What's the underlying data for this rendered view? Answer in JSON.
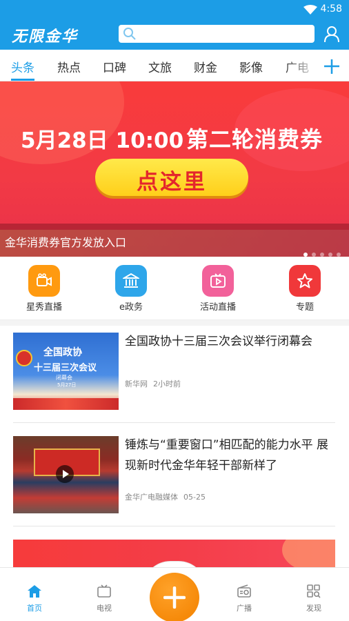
{
  "status_bar": {
    "time": "4:58"
  },
  "app": {
    "logo_text": "无限金华"
  },
  "search": {
    "placeholder": ""
  },
  "tabs": [
    {
      "label": "头条",
      "active": true
    },
    {
      "label": "热点"
    },
    {
      "label": "口碑"
    },
    {
      "label": "文旅"
    },
    {
      "label": "财金"
    },
    {
      "label": "影像"
    },
    {
      "label": "广电"
    }
  ],
  "banner": {
    "date_text": "5月28日 10:00",
    "title_text": "第二轮消费券",
    "button_text": "点这里",
    "caption": "金华消费券官方发放入口",
    "active_slide": 1,
    "slide_count": 5
  },
  "quick_actions": [
    {
      "label": "星秀直播",
      "icon": "camera-icon",
      "color": "#ff9a10"
    },
    {
      "label": "e政务",
      "icon": "government-building-icon",
      "color": "#2ea6ea"
    },
    {
      "label": "活动直播",
      "icon": "tv-play-icon",
      "color": "#f2619a"
    },
    {
      "label": "专题",
      "icon": "star-icon",
      "color": "#f0383a"
    }
  ],
  "news": [
    {
      "title": "全国政协十三届三次会议举行闭幕会",
      "source": "新华网",
      "time": "2小时前",
      "thumb_text": {
        "line1": "全国政协",
        "line2": "十三届三次会议",
        "line3": "闭幕会",
        "line4": "5月27日"
      }
    },
    {
      "title": "锤炼与“重要窗口”相匹配的能力水平 展现新时代金华年轻干部新样了",
      "source": "金华广电融媒体",
      "time": "05-25"
    }
  ],
  "bottom_nav": [
    {
      "label": "首页",
      "icon": "home-icon",
      "active": true
    },
    {
      "label": "电视",
      "icon": "tv-icon"
    },
    {
      "label": "广播",
      "icon": "radio-icon"
    },
    {
      "label": "发现",
      "icon": "discover-grid-icon"
    }
  ],
  "colors": {
    "primary": "#1c9de6",
    "accent": "#f68a0a",
    "banner_red": "#f23a45"
  }
}
